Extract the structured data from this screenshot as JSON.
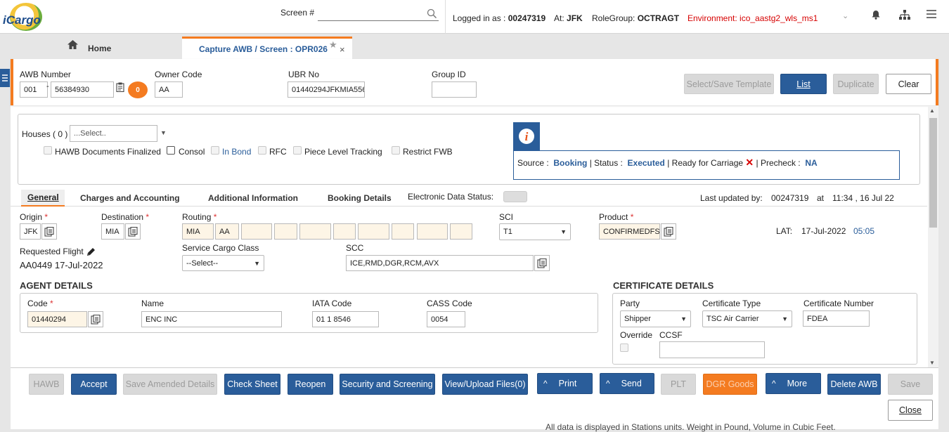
{
  "topbar": {
    "logo": "iCargo",
    "screen_label": "Screen #",
    "logged_in_label": "Logged in as :",
    "user_id": "00247319",
    "at_label": "At:",
    "station": "JFK",
    "rolegroup_label": "RoleGroup:",
    "rolegroup": "OCTRAGT",
    "environment": "Environment: ico_aastg2_wls_ms1"
  },
  "tabs": {
    "home": "Home",
    "active": "Capture AWB / Screen : OPR026"
  },
  "header": {
    "awb_label": "AWB Number",
    "awb_prefix": "001",
    "awb_number": "56384930",
    "awb_badge": "0",
    "owner_label": "Owner Code",
    "owner_value": "AA",
    "ubr_label": "UBR No",
    "ubr_value": "01440294JFKMIA556",
    "group_label": "Group ID",
    "group_value": "",
    "btn_template": "Select/Save Template",
    "btn_list": "List",
    "btn_duplicate": "Duplicate",
    "btn_clear": "Clear"
  },
  "houses": {
    "label": "Houses ( 0 )",
    "select_placeholder": "...Select..",
    "chk_hawb": "HAWB Documents Finalized",
    "chk_consol": "Consol",
    "chk_inbond": "In Bond",
    "chk_rfc": "RFC",
    "chk_piece": "Piece Level Tracking",
    "chk_restrict": "Restrict FWB"
  },
  "info": {
    "source_label": "Source :",
    "source_value": "Booking",
    "status_label": "| Status :",
    "status_value": "Executed",
    "rfc_label": "| Ready for Carriage",
    "precheck_label": "| Precheck :",
    "precheck_value": "NA"
  },
  "subtabs": {
    "general": "General",
    "charges": "Charges and Accounting",
    "additional": "Additional Information",
    "booking": "Booking Details",
    "eds_label": "Electronic Data Status:",
    "last_updated_label": "Last updated by:",
    "last_updated_user": "00247319",
    "at": "at",
    "last_updated_time": "11:34 , 16 Jul 22"
  },
  "general": {
    "origin_label": "Origin",
    "origin_value": "JFK",
    "dest_label": "Destination",
    "dest_value": "MIA",
    "routing_label": "Routing",
    "routing_1": "MIA",
    "routing_2": "AA",
    "sci_label": "SCI",
    "sci_value": "T1",
    "product_label": "Product",
    "product_value": "CONFIRMEDFS",
    "lat_label": "LAT:",
    "lat_date": "17-Jul-2022",
    "lat_time": "05:05",
    "req_flight_label": "Requested Flight",
    "req_flight_value": "AA0449 17-Jul-2022",
    "scc_class_label": "Service Cargo Class",
    "scc_class_value": "--Select--",
    "scc_label": "SCC",
    "scc_value": "ICE,RMD,DGR,RCM,AVX"
  },
  "agent": {
    "title": "AGENT DETAILS",
    "code_label": "Code",
    "code_value": "01440294",
    "name_label": "Name",
    "name_value": "ENC INC",
    "iata_label": "IATA Code",
    "iata_value": "01 1 8546",
    "cass_label": "CASS Code",
    "cass_value": "0054"
  },
  "cert": {
    "title": "CERTIFICATE DETAILS",
    "party_label": "Party",
    "party_value": "Shipper",
    "type_label": "Certificate Type",
    "type_value": "TSC Air Carrier",
    "number_label": "Certificate Number",
    "number_value": "FDEA",
    "override_label": "Override",
    "ccsf_label": "CCSF",
    "ccsf_value": ""
  },
  "footer": {
    "hawb": "HAWB",
    "accept": "Accept",
    "save_amended": "Save Amended Details",
    "check_sheet": "Check Sheet",
    "reopen": "Reopen",
    "security": "Security and Screening",
    "view_upload": "View/Upload Files(0)",
    "print": "Print",
    "send": "Send",
    "plt": "PLT",
    "dgr": "DGR Goods",
    "more": "More",
    "delete": "Delete AWB",
    "save": "Save",
    "close": "Close",
    "note": "All data is displayed in Stations units. Weight in Pound, Volume in Cubic Feet."
  }
}
